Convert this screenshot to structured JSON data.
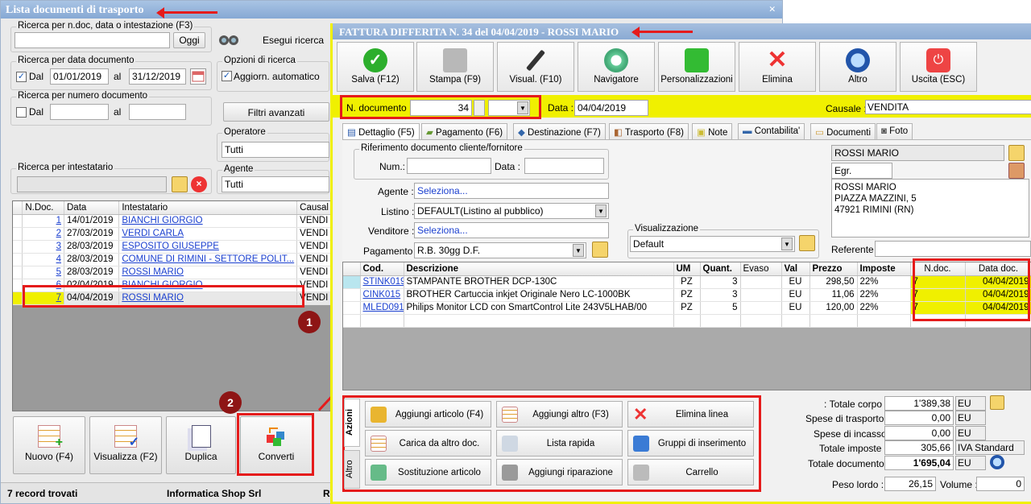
{
  "list_window": {
    "title": "Lista documenti di trasporto",
    "close": "×",
    "search_ndoc_label": "Ricerca per n.doc, data o intestazione (F3)",
    "ok_label": "Oggi",
    "esegui_label": "Esegui ricerca",
    "search_date_label": "Ricerca per data documento",
    "dal_label": "Dal",
    "al_label": "al",
    "date_from": "01/01/2019",
    "date_to": "31/12/2019",
    "search_num_label": "Ricerca per numero documento",
    "dal2_label": "Dal",
    "al2_label": "al",
    "opzioni_label": "Opzioni di ricerca",
    "aggiorn_label": "Aggiorn. automatico",
    "filtri_label": "Filtri avanzati",
    "operatore_label": "Operatore",
    "operatore_value": "Tutti",
    "agente_label": "Agente",
    "agente_value": "Tutti",
    "intestatario_label": "Ricerca per intestatario",
    "columns": [
      "N.Doc.",
      "Data",
      "Intestatario",
      "Causal"
    ],
    "rows": [
      {
        "n": "1",
        "data": "14/01/2019",
        "int": "BIANCHI GIORGIO",
        "c": "VENDI"
      },
      {
        "n": "2",
        "data": "27/03/2019",
        "int": "VERDI CARLA",
        "c": "VENDI"
      },
      {
        "n": "3",
        "data": "28/03/2019",
        "int": "ESPOSITO GIUSEPPE",
        "c": "VENDI"
      },
      {
        "n": "4",
        "data": "28/03/2019",
        "int": "COMUNE DI RIMINI - SETTORE POLIT...",
        "c": "VENDI"
      },
      {
        "n": "5",
        "data": "28/03/2019",
        "int": "ROSSI MARIO",
        "c": "VENDI"
      },
      {
        "n": "6",
        "data": "02/04/2019",
        "int": "BIANCHI GIORGIO",
        "c": "VENDI"
      },
      {
        "n": "7",
        "data": "04/04/2019",
        "int": "ROSSI MARIO",
        "c": "VENDI"
      }
    ],
    "buttons": [
      "Nuovo (F4)",
      "Visualizza (F2)",
      "Duplica",
      "Converti"
    ],
    "status_count": "7 record trovati",
    "status_company": "Informatica Shop Srl",
    "status_tail": "R",
    "badge1": "1",
    "badge2": "2"
  },
  "invoice_window": {
    "title": "FATTURA DIFFERITA N. 34 del 04/04/2019 - ROSSI MARIO",
    "toolbar": [
      "Salva (F12)",
      "Stampa (F9)",
      "Visual. (F10)",
      "Navigatore",
      "Personalizzazioni",
      "Elimina",
      "Altro",
      "Uscita (ESC)"
    ],
    "ndoc_label": "N. documento :",
    "ndoc_value": "34",
    "data_label": "Data :",
    "data_value": "04/04/2019",
    "causale_label": "Causale :",
    "causale_value": "VENDITA",
    "tabs": [
      "Dettaglio (F5)",
      "Pagamento (F6)",
      "Destinazione (F7)",
      "Trasporto (F8)",
      "Note",
      "Contabilita'",
      "Documenti",
      "Foto"
    ],
    "rif_label": "Riferimento documento cliente/fornitore",
    "num_label": "Num.:",
    "data2_label": "Data :",
    "agente_label": "Agente :",
    "agente_value": "Seleziona...",
    "listino_label": "Listino :",
    "listino_value": "DEFAULT(Listino al pubblico)",
    "venditore_label": "Venditore :",
    "venditore_value": "Seleziona...",
    "pagamento_label": "Pagamento :",
    "pagamento_value": "R.B. 30gg D.F.",
    "visual_label": "Visualizzazione",
    "visual_value": "Default",
    "cliente_name": "ROSSI MARIO",
    "egr": "Egr.",
    "address": [
      "ROSSI MARIO",
      "PIAZZA MAZZINI, 5",
      "47921 RIMINI (RN)"
    ],
    "referente_label": "Referente",
    "columns": [
      "Cod.",
      "Descrizione",
      "UM",
      "Quant.",
      "Evaso",
      "Val",
      "Prezzo",
      "Imposte",
      "N.doc.",
      "Data doc."
    ],
    "rows": [
      {
        "cod": "STINK019",
        "desc": "STAMPANTE BROTHER DCP-130C",
        "um": "PZ",
        "q": "3",
        "val": "EU",
        "prezzo": "298,50",
        "imp": "22%",
        "nd": "7",
        "dd": "04/04/2019"
      },
      {
        "cod": "CINK015",
        "desc": "BROTHER Cartuccia inkjet Originale Nero LC-1000BK",
        "um": "PZ",
        "q": "3",
        "val": "EU",
        "prezzo": "11,06",
        "imp": "22%",
        "nd": "7",
        "dd": "04/04/2019"
      },
      {
        "cod": "MLED091",
        "desc": "Philips Monitor LCD con SmartControl Lite 243V5LHAB/00",
        "um": "PZ",
        "q": "5",
        "val": "EU",
        "prezzo": "120,00",
        "imp": "22%",
        "nd": "7",
        "dd": "04/04/2019"
      }
    ],
    "side_tab_1": "Azioni",
    "side_tab_2": "Altro",
    "actions": [
      "Aggiungi articolo (F4)",
      "Aggiungi altro (F3)",
      "Elimina linea",
      "Carica da altro doc.",
      "Lista rapida",
      "Gruppi di inserimento",
      "Sostituzione articolo",
      "Aggiungi riparazione",
      "Carrello"
    ],
    "totals": [
      {
        "label": "Totale corpo :",
        "value": "1'389,38",
        "unit": "EU"
      },
      {
        "label": "Spese di trasporto :",
        "value": "0,00",
        "unit": "EU"
      },
      {
        "label": "Spese di incasso :",
        "value": "0,00",
        "unit": "EU"
      },
      {
        "label": "Totale imposte :",
        "value": "305,66",
        "unit": "IVA Standard"
      },
      {
        "label": "Totale documento :",
        "value": "1'695,04",
        "unit": "EU"
      }
    ],
    "peso_label": "Peso lordo :",
    "peso_value": "26,15",
    "volume_label": "Volume :",
    "volume_value": "0"
  },
  "colors": {
    "highlight": "#f0f000",
    "annotation": "#e51b1b",
    "badge": "#8e1515"
  }
}
